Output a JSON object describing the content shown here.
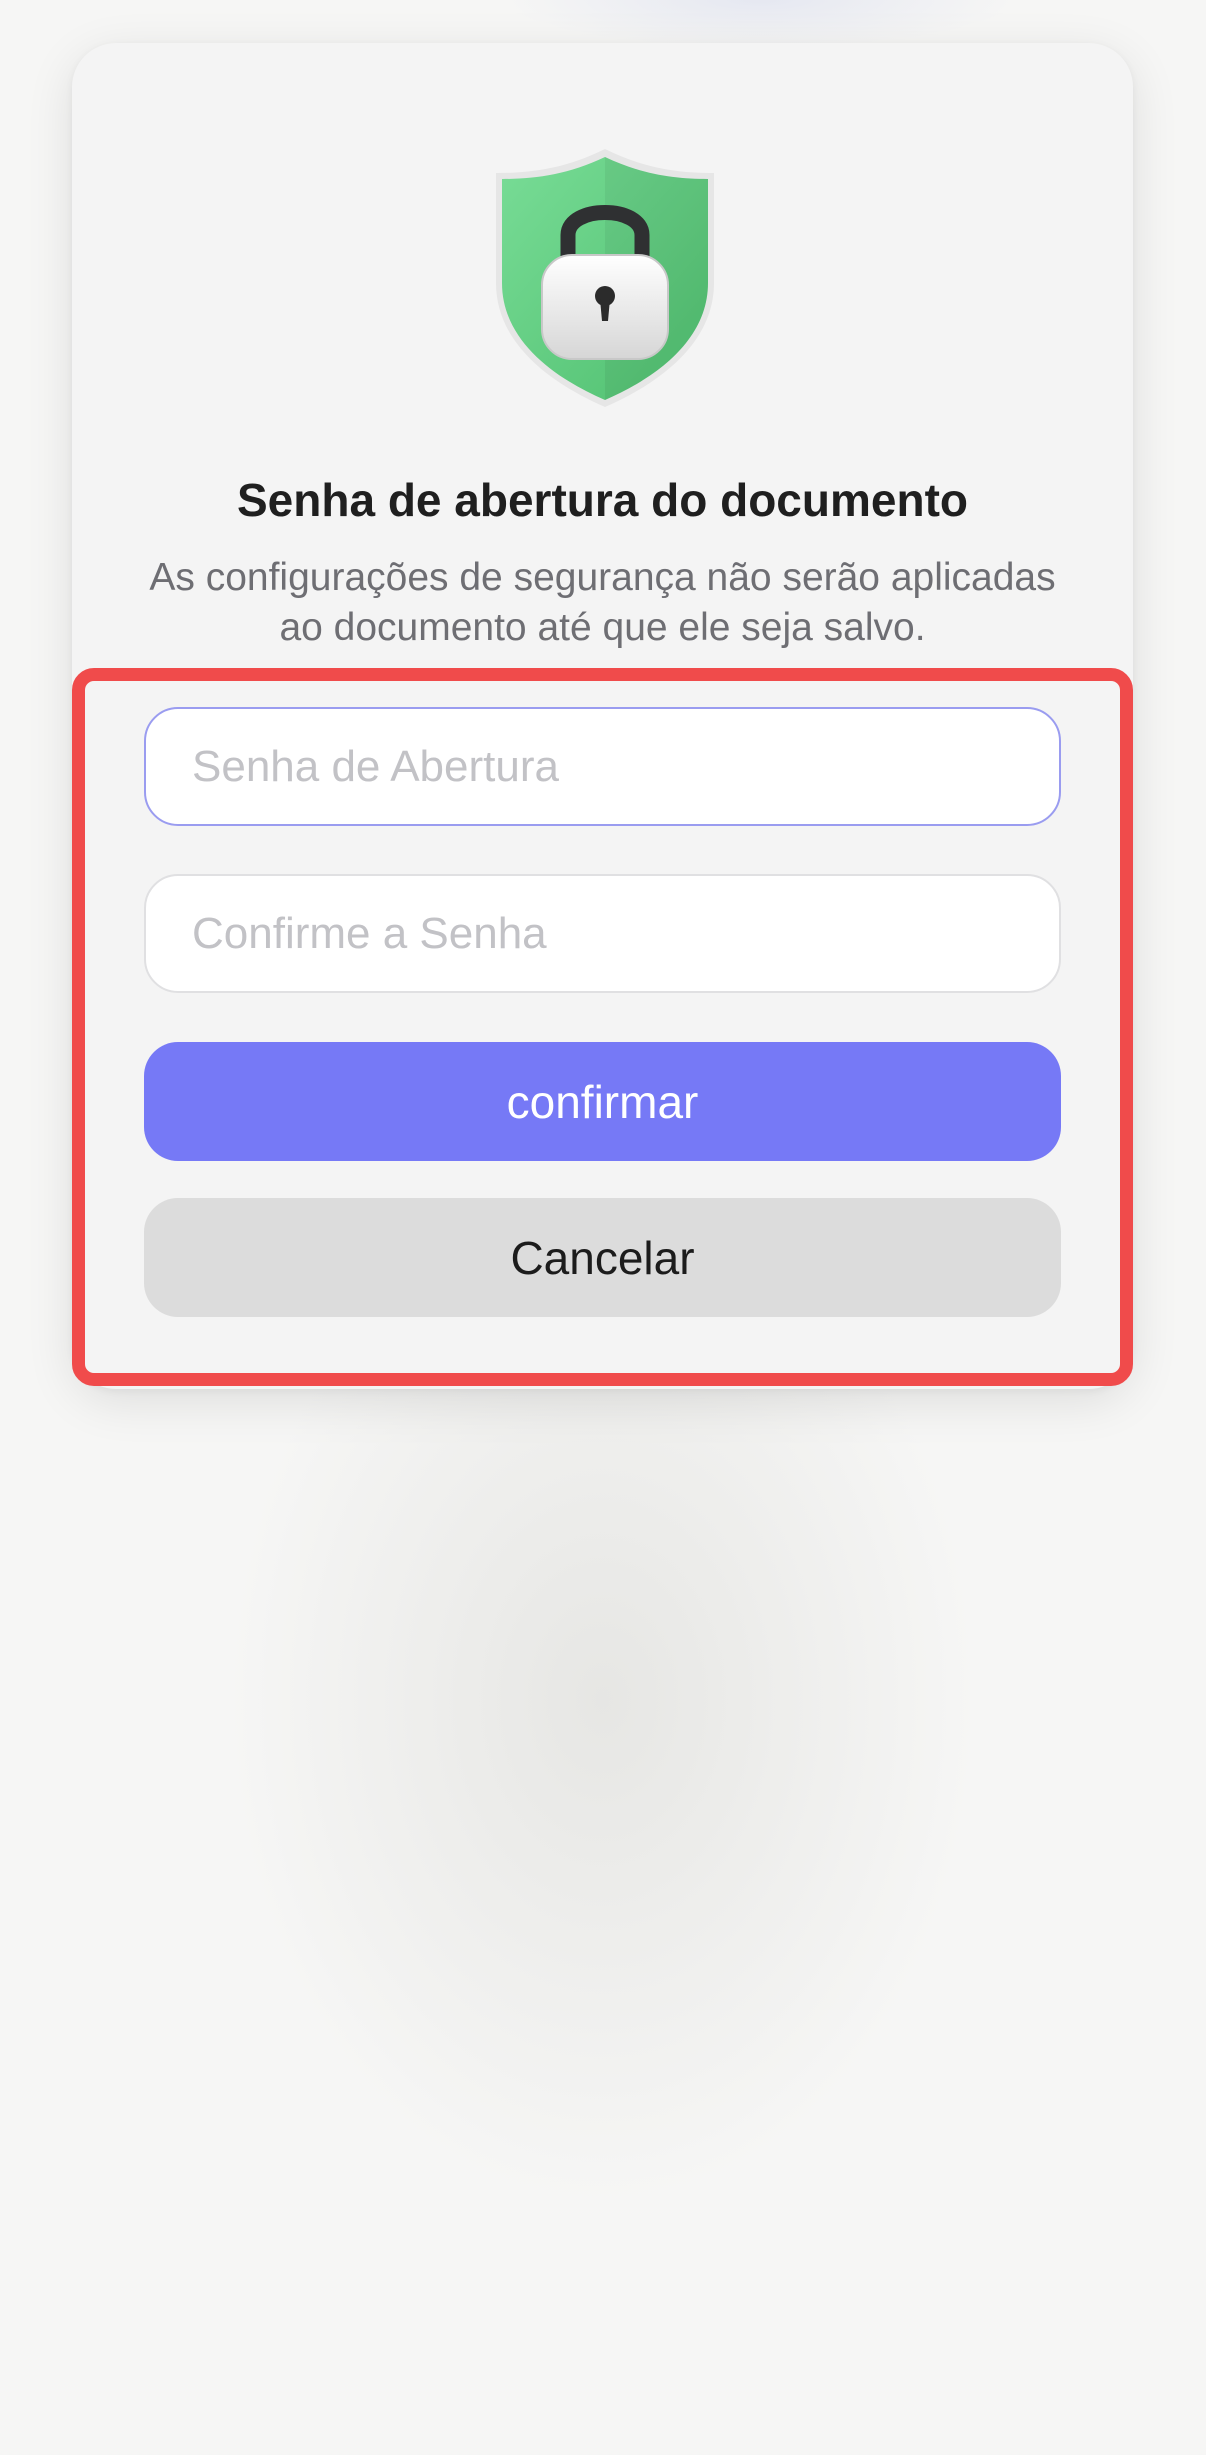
{
  "dialog": {
    "icon": "shield-lock-icon",
    "title": "Senha de abertura do documento",
    "subtitle": "As configurações de segurança não serão aplicadas ao documento até que ele seja salvo.",
    "open_password_placeholder": "Senha de Abertura",
    "confirm_password_placeholder": "Confirme a Senha",
    "confirm_label": "confirmar",
    "cancel_label": "Cancelar"
  },
  "colors": {
    "accent": "#7679f6",
    "shield_green": "#5fcf80",
    "highlight": "#f04b4b",
    "cancel_bg": "#dcdcdc"
  }
}
